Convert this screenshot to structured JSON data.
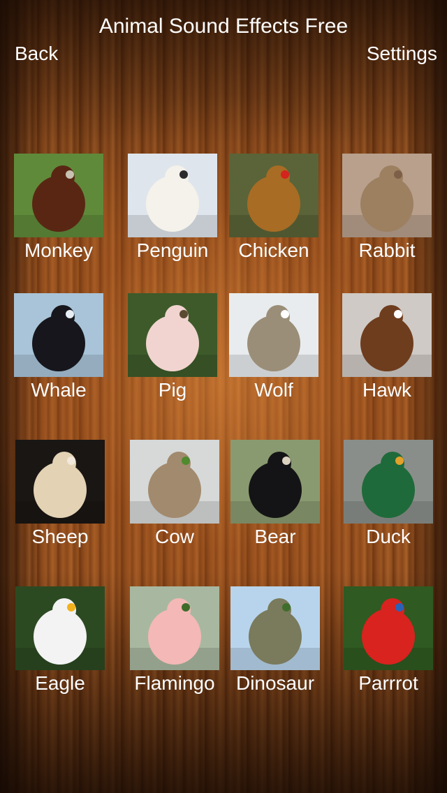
{
  "header": {
    "title": "Animal Sound Effects Free",
    "back_label": "Back",
    "settings_label": "Settings"
  },
  "animals": [
    {
      "label": "Monkey",
      "icon": "orangutan-photo",
      "colors": {
        "bg": "#5f8a3a",
        "main": "#5a2614",
        "accent": "#c9c2b2"
      }
    },
    {
      "label": "Penguin",
      "icon": "emperor-penguin-photo",
      "colors": {
        "bg": "#dfe5ec",
        "main": "#f4f2ea",
        "accent": "#2b2b2e"
      }
    },
    {
      "label": "Chicken",
      "icon": "hen-photo",
      "colors": {
        "bg": "#5a6438",
        "main": "#a86c24",
        "accent": "#d3241d"
      }
    },
    {
      "label": "Rabbit",
      "icon": "hare-photo",
      "colors": {
        "bg": "#b8a08c",
        "main": "#9c8060",
        "accent": "#7d5f48"
      }
    },
    {
      "label": "Whale",
      "icon": "orca-photo",
      "colors": {
        "bg": "#a9c4d8",
        "main": "#16161c",
        "accent": "#e6eef4"
      }
    },
    {
      "label": "Pig",
      "icon": "pig-photo",
      "colors": {
        "bg": "#3e5a2a",
        "main": "#f1d4cf",
        "accent": "#5b4a32"
      }
    },
    {
      "label": "Wolf",
      "icon": "coyote-photo",
      "colors": {
        "bg": "#e9ecee",
        "main": "#9b8e78",
        "accent": "#ffffff"
      }
    },
    {
      "label": "Hawk",
      "icon": "hawk-photo",
      "colors": {
        "bg": "#cfcac5",
        "main": "#6e3d1e",
        "accent": "#ffffff"
      }
    },
    {
      "label": "Sheep",
      "icon": "sheep-photo",
      "colors": {
        "bg": "#1a1614",
        "main": "#e3d2b4",
        "accent": "#f2e8dc"
      }
    },
    {
      "label": "Cow",
      "icon": "cow-photo",
      "colors": {
        "bg": "#d6d9d8",
        "main": "#a28a6e",
        "accent": "#4f8a2e"
      }
    },
    {
      "label": "Bear",
      "icon": "sun-bear-photo",
      "colors": {
        "bg": "#8a9a70",
        "main": "#141416",
        "accent": "#dcd2c0"
      }
    },
    {
      "label": "Duck",
      "icon": "mallard-photo",
      "colors": {
        "bg": "#8a8e8a",
        "main": "#1f6a3a",
        "accent": "#e2a12a"
      }
    },
    {
      "label": "Eagle",
      "icon": "bald-eagle-photo",
      "colors": {
        "bg": "#2c4a22",
        "main": "#f3f3f3",
        "accent": "#f2b21e"
      }
    },
    {
      "label": "Flamingo",
      "icon": "flamingo-photo",
      "colors": {
        "bg": "#a8b8a0",
        "main": "#f4b8b6",
        "accent": "#3f6b2a"
      }
    },
    {
      "label": "Dinosaur",
      "icon": "t-rex-photo",
      "colors": {
        "bg": "#b8d4ec",
        "main": "#7a7a5c",
        "accent": "#3f6e2c"
      }
    },
    {
      "label": "Parrrot",
      "icon": "macaw-photo",
      "colors": {
        "bg": "#2f5a22",
        "main": "#d8231e",
        "accent": "#2a62b8"
      }
    }
  ]
}
